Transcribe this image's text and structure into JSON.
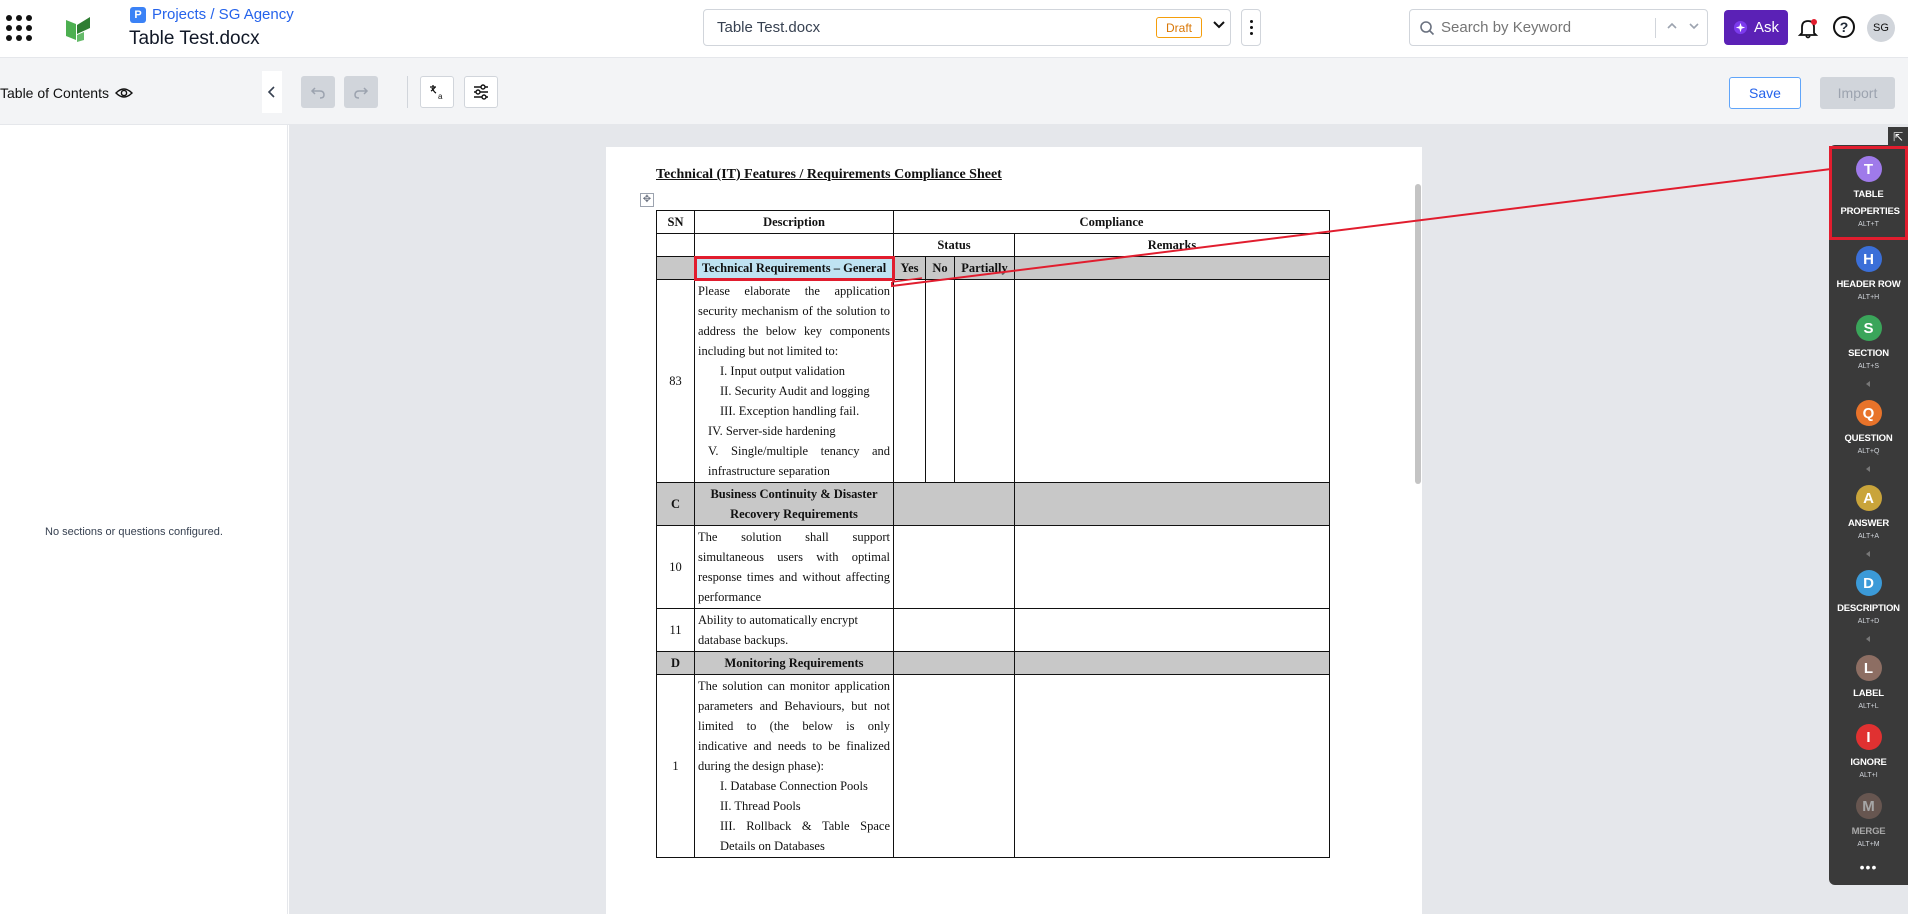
{
  "header": {
    "breadcrumb": "Projects / SG Agency",
    "breadcrumb_icon": "P",
    "title": "Table Test.docx",
    "file_select": "Table Test.docx",
    "status_badge": "Draft",
    "search_placeholder": "Search by Keyword",
    "ask_label": "Ask",
    "avatar_initials": "SG"
  },
  "toc": {
    "title": "Table of Contents",
    "empty_text": "No sections or questions configured."
  },
  "toolbar": {
    "save_label": "Save",
    "import_label": "Import"
  },
  "document": {
    "heading": "Technical (IT) Features / Requirements Compliance Sheet",
    "header": {
      "sn": "SN",
      "description": "Description",
      "compliance": "Compliance",
      "status": "Status",
      "remarks": "Remarks",
      "yes": "Yes",
      "no": "No",
      "partially": "Partially"
    },
    "section_general": "Technical Requirements – General",
    "row83": {
      "sn": "83",
      "text": "Please elaborate the application security mechanism of the solution to address the below key components including but not limited to:",
      "items": [
        "I.  Input output validation",
        "II.  Security Audit and logging",
        "III.     Exception handling fail.",
        "IV.  Server-side hardening",
        "V.  Single/multiple tenancy and infrastructure separation"
      ]
    },
    "section_c": {
      "sn": "C",
      "title": "Business Continuity & Disaster Recovery Requirements"
    },
    "row10": {
      "sn": "10",
      "text": "The solution shall support simultaneous users with optimal response times and without affecting performance"
    },
    "row11": {
      "sn": "11",
      "text": "Ability to automatically encrypt database backups."
    },
    "section_d": {
      "sn": "D",
      "title": "Monitoring Requirements"
    },
    "row1": {
      "sn": "1",
      "text": "The solution can monitor application parameters and Behaviours, but not limited to (the below is only indicative and needs to be finalized during the design phase):",
      "items": [
        "I.  Database Connection Pools",
        "II.  Thread Pools",
        "III.  Rollback & Table Space Details on Databases"
      ]
    }
  },
  "palette": {
    "items": [
      {
        "letter": "T",
        "label": "TABLE PROPERTIES",
        "shortcut": "ALT+T",
        "color": "#9f7aea"
      },
      {
        "letter": "H",
        "label": "HEADER ROW",
        "shortcut": "ALT+H",
        "color": "#3b6fd8"
      },
      {
        "letter": "S",
        "label": "SECTION",
        "shortcut": "ALT+S",
        "color": "#3aa55a"
      },
      {
        "letter": "Q",
        "label": "QUESTION",
        "shortcut": "ALT+Q",
        "color": "#e8732a"
      },
      {
        "letter": "A",
        "label": "ANSWER",
        "shortcut": "ALT+A",
        "color": "#c9a43a"
      },
      {
        "letter": "D",
        "label": "DESCRIPTION",
        "shortcut": "ALT+D",
        "color": "#3b9ad8"
      },
      {
        "letter": "L",
        "label": "LABEL",
        "shortcut": "ALT+L",
        "color": "#8d6e63"
      },
      {
        "letter": "I",
        "label": "IGNORE",
        "shortcut": "ALT+I",
        "color": "#e03131"
      },
      {
        "letter": "M",
        "label": "MERGE",
        "shortcut": "ALT+M",
        "color": "#8d6e63"
      }
    ],
    "more": "•••"
  },
  "colors": {
    "accent": "#5b21b6",
    "selection": "#e11d2e",
    "highlight_cell": "#bfe3f2"
  }
}
